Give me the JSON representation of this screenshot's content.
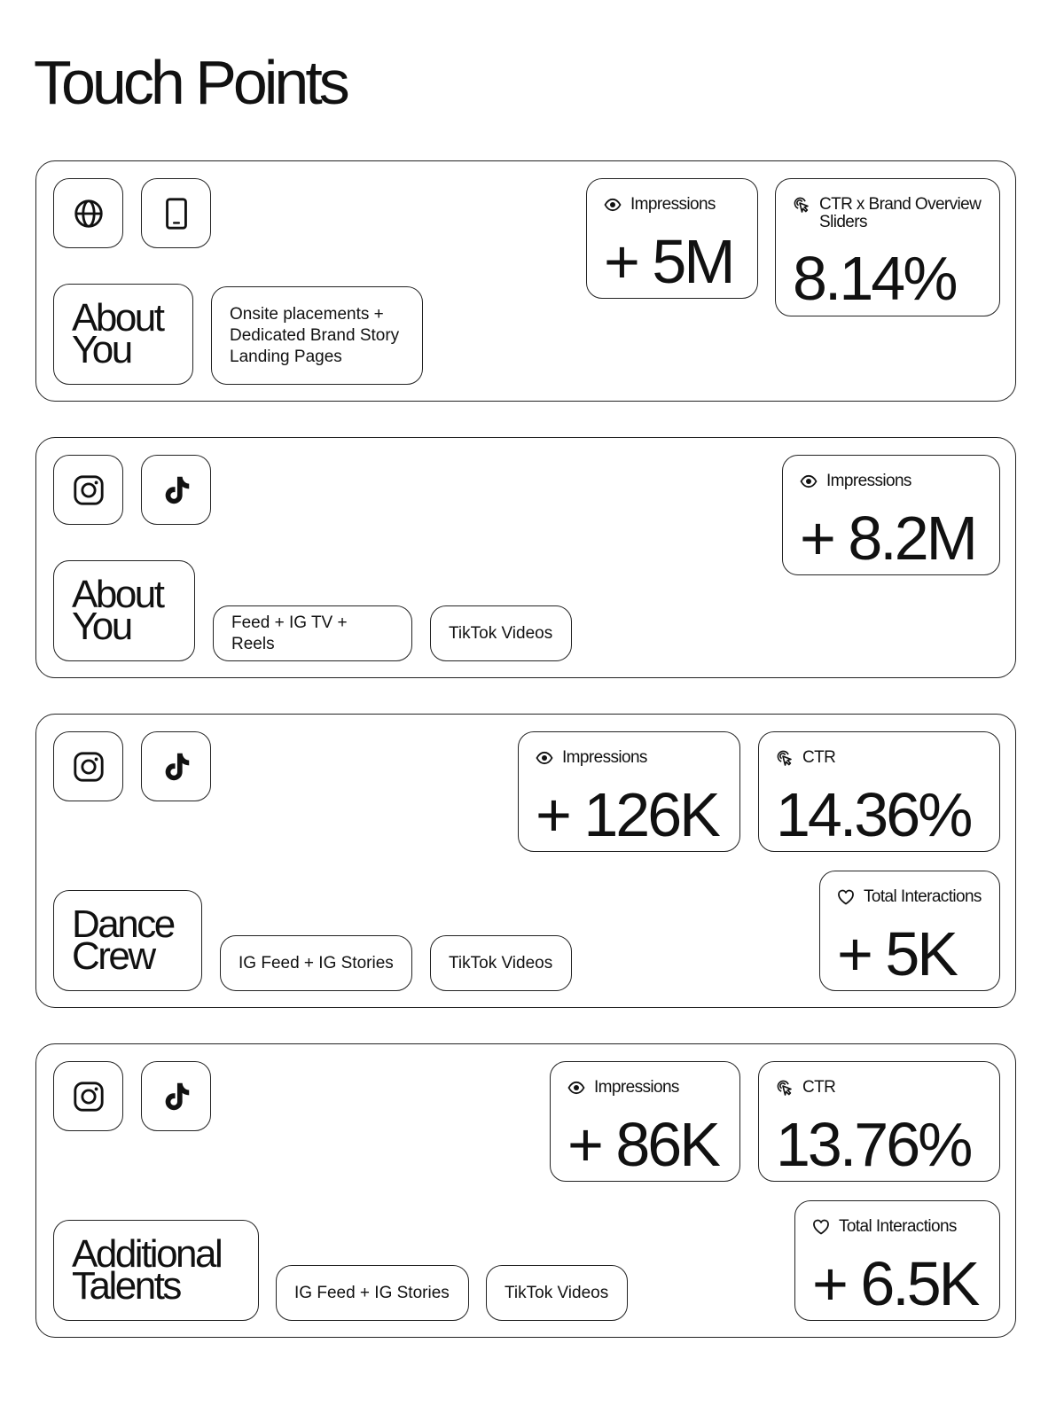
{
  "page": {
    "title": "Touch Points"
  },
  "cards": [
    {
      "name": [
        "About",
        "You"
      ],
      "channels": [
        "Onsite placements + Dedicated Brand Story Landing Pages"
      ],
      "stats": [
        {
          "icon": "eye-icon",
          "label": "Impressions",
          "value": "+ 5M"
        },
        {
          "icon": "cursor-click-icon",
          "label": "CTR x Brand Overview Sliders",
          "value": "8.14%"
        }
      ]
    },
    {
      "name": [
        "About",
        "You"
      ],
      "channels": [
        "Feed + IG TV + Reels",
        "TikTok Videos"
      ],
      "stats": [
        {
          "icon": "eye-icon",
          "label": "Impressions",
          "value": "+ 8.2M"
        }
      ]
    },
    {
      "name": [
        "Dance",
        "Crew"
      ],
      "channels": [
        "IG Feed + IG Stories",
        "TikTok Videos"
      ],
      "stats": [
        {
          "icon": "eye-icon",
          "label": "Impressions",
          "value": "+ 126K"
        },
        {
          "icon": "cursor-click-icon",
          "label": "CTR",
          "value": "14.36%"
        },
        {
          "icon": "heart-icon",
          "label": "Total Interactions",
          "value": "+ 5K"
        }
      ]
    },
    {
      "name": [
        "Additional",
        "Talents"
      ],
      "channels": [
        "IG Feed + IG Stories",
        "TikTok Videos"
      ],
      "stats": [
        {
          "icon": "eye-icon",
          "label": "Impressions",
          "value": "+ 86K"
        },
        {
          "icon": "cursor-click-icon",
          "label": "CTR",
          "value": "13.76%"
        },
        {
          "icon": "heart-icon",
          "label": "Total Interactions",
          "value": "+ 6.5K"
        }
      ]
    }
  ],
  "icons": {
    "card0": [
      "globe-icon",
      "tablet-icon"
    ],
    "card1": [
      "instagram-icon",
      "tiktok-icon"
    ],
    "card2": [
      "instagram-icon",
      "tiktok-icon"
    ],
    "card3": [
      "instagram-icon",
      "tiktok-icon"
    ]
  }
}
